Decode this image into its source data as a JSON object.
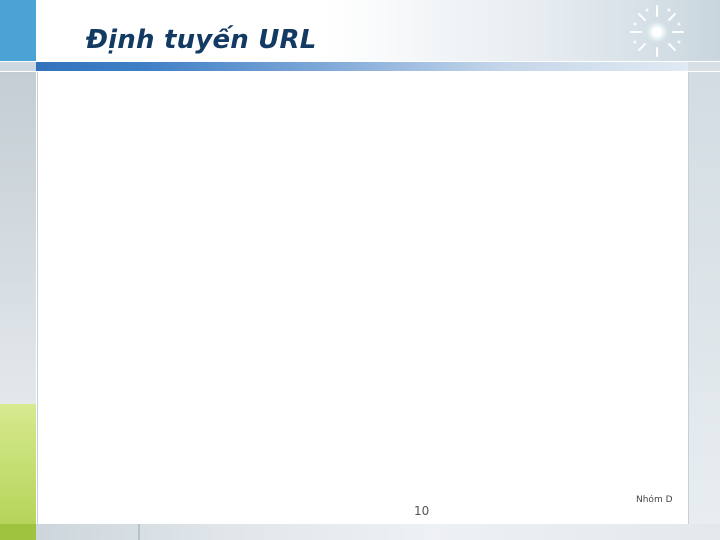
{
  "slide": {
    "title": "Định tuyến URL",
    "page_number": "10",
    "footer": "Nhóm D"
  },
  "colors": {
    "title": "#123a62",
    "accent_blue": "#4aa3d4",
    "accent_green": "#b6d45a",
    "underline_blue": "#2f6fb8"
  },
  "icons": {
    "decoration": "sunburst-icon"
  }
}
